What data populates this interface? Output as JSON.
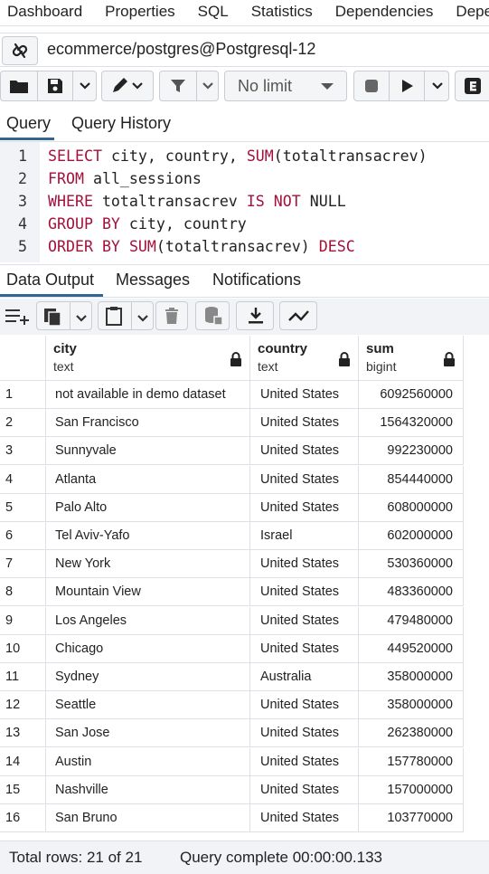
{
  "topnav": {
    "tabs": [
      "Dashboard",
      "Properties",
      "SQL",
      "Statistics",
      "Dependencies",
      "Dependents"
    ]
  },
  "connection": {
    "label": "ecommerce/postgres@Postgresql-12",
    "icon": "unlink-icon"
  },
  "toolbar": {
    "limit_value": "No limit",
    "icons": [
      "folder-icon",
      "save-icon",
      "chevron-down-icon",
      "pen-icon",
      "filter-icon",
      "stop-icon",
      "play-icon",
      "explain-icon"
    ]
  },
  "query_tabs": [
    "Query",
    "Query History"
  ],
  "editor": {
    "lines": [
      {
        "n": "1",
        "parts": [
          [
            "kw",
            "SELECT"
          ],
          [
            "t",
            " city, country, "
          ],
          [
            "kw",
            "SUM"
          ],
          [
            "t",
            "(totaltransacrev)"
          ]
        ]
      },
      {
        "n": "2",
        "parts": [
          [
            "kw",
            "FROM"
          ],
          [
            "t",
            " all_sessions"
          ]
        ]
      },
      {
        "n": "3",
        "parts": [
          [
            "kw",
            "WHERE"
          ],
          [
            "t",
            " totaltransacrev "
          ],
          [
            "kw",
            "IS NOT"
          ],
          [
            "t",
            " NULL"
          ]
        ]
      },
      {
        "n": "4",
        "parts": [
          [
            "kw",
            "GROUP BY"
          ],
          [
            "t",
            " city, country"
          ]
        ]
      },
      {
        "n": "5",
        "parts": [
          [
            "kw",
            "ORDER BY"
          ],
          [
            "t",
            " "
          ],
          [
            "kw",
            "SUM"
          ],
          [
            "t",
            "(totaltransacrev) "
          ],
          [
            "kw",
            "DESC"
          ]
        ]
      }
    ]
  },
  "output_tabs": [
    "Data Output",
    "Messages",
    "Notifications"
  ],
  "grid": {
    "columns": [
      {
        "name": "city",
        "type": "text"
      },
      {
        "name": "country",
        "type": "text"
      },
      {
        "name": "sum",
        "type": "bigint"
      }
    ],
    "rows": [
      [
        "1",
        "not available in demo dataset",
        "United States",
        "6092560000"
      ],
      [
        "2",
        "San Francisco",
        "United States",
        "1564320000"
      ],
      [
        "3",
        "Sunnyvale",
        "United States",
        "992230000"
      ],
      [
        "4",
        "Atlanta",
        "United States",
        "854440000"
      ],
      [
        "5",
        "Palo Alto",
        "United States",
        "608000000"
      ],
      [
        "6",
        "Tel Aviv-Yafo",
        "Israel",
        "602000000"
      ],
      [
        "7",
        "New York",
        "United States",
        "530360000"
      ],
      [
        "8",
        "Mountain View",
        "United States",
        "483360000"
      ],
      [
        "9",
        "Los Angeles",
        "United States",
        "479480000"
      ],
      [
        "10",
        "Chicago",
        "United States",
        "449520000"
      ],
      [
        "11",
        "Sydney",
        "Australia",
        "358000000"
      ],
      [
        "12",
        "Seattle",
        "United States",
        "358000000"
      ],
      [
        "13",
        "San Jose",
        "United States",
        "262380000"
      ],
      [
        "14",
        "Austin",
        "United States",
        "157780000"
      ],
      [
        "15",
        "Nashville",
        "United States",
        "157000000"
      ],
      [
        "16",
        "San Bruno",
        "United States",
        "103770000"
      ]
    ]
  },
  "status": {
    "total_rows": "Total rows: 21 of 21",
    "query_complete": "Query complete 00:00:00.133"
  }
}
